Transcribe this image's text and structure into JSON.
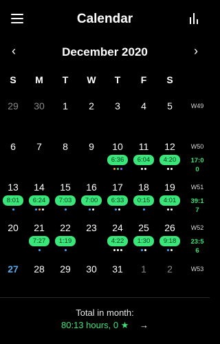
{
  "header": {
    "title": "Calendar",
    "menu_icon": "hamburger-menu-icon",
    "stats_icon": "bar-chart-icon"
  },
  "month_nav": {
    "title": "December 2020",
    "prev": "‹",
    "next": "›"
  },
  "weekdays": [
    "S",
    "M",
    "T",
    "W",
    "T",
    "F",
    "S"
  ],
  "weeks": [
    {
      "label": "W49",
      "total": [],
      "days": [
        {
          "d": "29",
          "muted": true
        },
        {
          "d": "30",
          "muted": true
        },
        {
          "d": "1"
        },
        {
          "d": "2"
        },
        {
          "d": "3"
        },
        {
          "d": "4"
        },
        {
          "d": "5"
        }
      ]
    },
    {
      "label": "W50",
      "total": [
        "17:0",
        "0"
      ],
      "days": [
        {
          "d": "6"
        },
        {
          "d": "7"
        },
        {
          "d": "8"
        },
        {
          "d": "9"
        },
        {
          "d": "10",
          "badge": "6:36",
          "dots": [
            "#ff9a3c",
            "#3ae57a",
            "#9a6cff"
          ]
        },
        {
          "d": "11",
          "badge": "6:04",
          "dots": [
            "#ffffff",
            "#ffffff"
          ]
        },
        {
          "d": "12",
          "badge": "4:20",
          "dots": [
            "#ffffff",
            "#ffffff"
          ]
        }
      ]
    },
    {
      "label": "W51",
      "total": [
        "39:1",
        "7"
      ],
      "days": [
        {
          "d": "13",
          "badge": "8:01",
          "dots": [
            "#4aa8ff"
          ]
        },
        {
          "d": "14",
          "badge": "6:24",
          "dots": [
            "#4aa8ff",
            "#ff9a3c",
            "#ffffff"
          ]
        },
        {
          "d": "15",
          "badge": "7:03",
          "dots": [
            "#4aa8ff"
          ]
        },
        {
          "d": "16",
          "badge": "7:00",
          "dots": [
            "#4aa8ff",
            "#ffffff"
          ]
        },
        {
          "d": "17",
          "badge": "6:33",
          "dots": [
            "#4aa8ff",
            "#ffffff"
          ]
        },
        {
          "d": "18",
          "badge": "0:15",
          "dots": [
            "#4aa8ff"
          ]
        },
        {
          "d": "19",
          "badge": "4:01",
          "dots": [
            "#ffffff",
            "#ffffff"
          ]
        }
      ]
    },
    {
      "label": "W52",
      "total": [
        "23:5",
        "6"
      ],
      "days": [
        {
          "d": "20"
        },
        {
          "d": "21",
          "badge": "7:27",
          "dots": [
            "#4aa8ff"
          ]
        },
        {
          "d": "22",
          "badge": "1:19",
          "dots": [
            "#4aa8ff"
          ]
        },
        {
          "d": "23"
        },
        {
          "d": "24",
          "badge": "4:22",
          "dots": [
            "#ffffff",
            "#ffffff",
            "#ffffff"
          ]
        },
        {
          "d": "25",
          "badge": "1:30",
          "dots": [
            "#4aa8ff",
            "#ffffff"
          ]
        },
        {
          "d": "26",
          "badge": "9:18",
          "dots": [
            "#4aa8ff",
            "#ffffff"
          ]
        }
      ]
    },
    {
      "label": "W53",
      "total": [],
      "days": [
        {
          "d": "27",
          "today": true
        },
        {
          "d": "28"
        },
        {
          "d": "29"
        },
        {
          "d": "30"
        },
        {
          "d": "31"
        },
        {
          "d": "1",
          "muted": true
        },
        {
          "d": "2",
          "muted": true
        }
      ]
    }
  ],
  "footer": {
    "label": "Total in month:",
    "value": "80:13 hours,",
    "stars": "0 ★",
    "arrow": "→"
  },
  "colors": {
    "accent": "#3ae57a",
    "today": "#5aa9e6"
  }
}
